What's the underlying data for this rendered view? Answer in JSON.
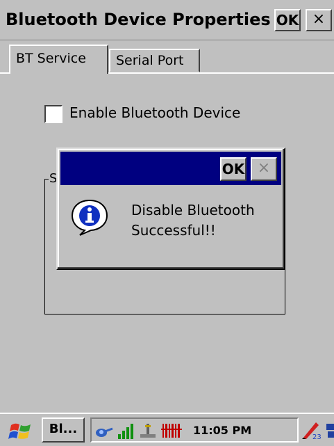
{
  "window": {
    "title": "Bluetooth Device Properties",
    "ok_label": "OK",
    "close_label": "×"
  },
  "tabs": [
    {
      "label": "BT Service",
      "active": true
    },
    {
      "label": "Serial Port",
      "active": false
    }
  ],
  "bt_service": {
    "enable_checkbox_label": "Enable Bluetooth Device",
    "enable_checked": false,
    "group_label_fragment": "S"
  },
  "dialog": {
    "ok_label": "OK",
    "close_label": "×",
    "message": "Disable Bluetooth\nSuccessful!!",
    "icon": "info-icon"
  },
  "taskbar": {
    "task_button_label": "Bl...",
    "clock": "11:05 PM",
    "tray_icons": [
      "bluetooth-icon",
      "signal-icon",
      "network-icon",
      "barcode-icon"
    ]
  },
  "colors": {
    "face": "#c0c0c0",
    "dialog_title": "#000080"
  }
}
